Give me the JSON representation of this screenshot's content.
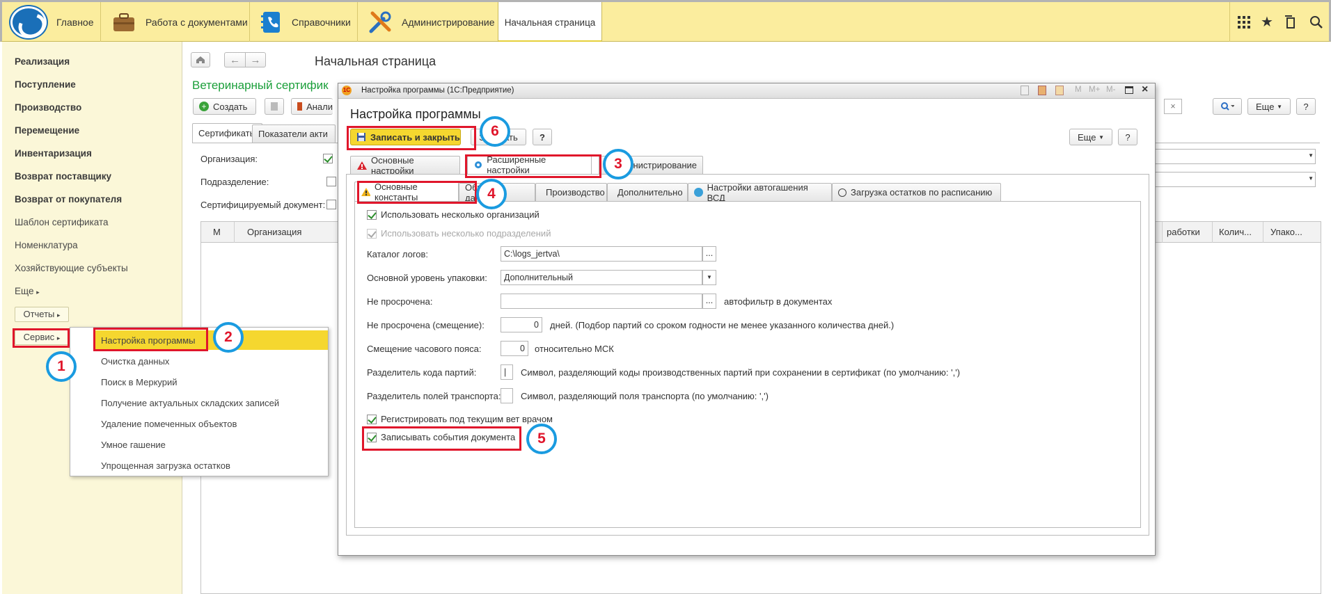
{
  "topbar": {
    "sections": [
      {
        "label": "Главное",
        "icon": "logo-icon"
      },
      {
        "label": "Работа с документами",
        "icon": "briefcase-icon"
      },
      {
        "label": "Справочники",
        "icon": "phonebook-icon"
      },
      {
        "label": "Администрирование",
        "icon": "tools-icon"
      },
      {
        "label": "Начальная страница",
        "icon": ""
      }
    ],
    "right_icons": [
      "apps-grid-icon",
      "star-icon",
      "history-icon",
      "search-icon"
    ]
  },
  "sidebar": {
    "items": [
      {
        "label": "Реализация",
        "bold": true
      },
      {
        "label": "Поступление",
        "bold": true
      },
      {
        "label": "Производство",
        "bold": true
      },
      {
        "label": "Перемещение",
        "bold": true
      },
      {
        "label": "Инвентаризация",
        "bold": true
      },
      {
        "label": "Возврат поставщику",
        "bold": true
      },
      {
        "label": "Возврат от покупателя",
        "bold": true
      },
      {
        "label": "Шаблон сертификата",
        "bold": false
      },
      {
        "label": "Номенклатура",
        "bold": false
      },
      {
        "label": "Хозяйствующие субъекты",
        "bold": false
      },
      {
        "label": "Еще",
        "bold": false
      }
    ],
    "reports_label": "Отчеты",
    "service_label": "Сервис"
  },
  "service_menu": {
    "items": [
      "Настройка программы",
      "Очистка данных",
      "Поиск в Меркурий",
      "Получение актуальных складских записей",
      "Удаление помеченных объектов",
      "Умное гашение",
      "Упрощенная загрузка остатков"
    ]
  },
  "main": {
    "page_title": "Начальная страница",
    "section_title": "Ветеринарный сертифик",
    "create_label": "Создать",
    "analysis_label": "Анали",
    "more_label": "Еще",
    "help_label": "?",
    "tabs": [
      "Сертификаты",
      "Показатели акти"
    ],
    "filters": [
      "Организация:",
      "Подразделение:",
      "Сертифицируемый документ:"
    ],
    "table_headers_left": [
      "М",
      "Организация"
    ],
    "table_headers_right": [
      "работки",
      "Колич...",
      "Упако..."
    ]
  },
  "dialog": {
    "window_title": "Настройка программы  (1С:Предприятие)",
    "title_icons": [
      "save-icon",
      "calculator-icon",
      "calendar-icon",
      "m-icon",
      "m-plus-icon",
      "m-minus-icon",
      "maximize-icon",
      "close-icon"
    ],
    "memory_labels": [
      "M",
      "M+",
      "M-"
    ],
    "heading": "Настройка программы",
    "save_close_label": "Записать и закрыть",
    "save_label": "Записать",
    "more_label": "Еще",
    "help_label": "?",
    "outer_tabs": [
      "Основные настройки",
      "Расширенные настройки",
      "Администрирование"
    ],
    "inner_tabs": [
      "Основные константы",
      "Обмен данными",
      "Производство",
      "Дополнительно",
      "Настройки автогашения ВСД",
      "Загрузка остатков по расписанию"
    ],
    "form": {
      "multi_org_label": "Использовать несколько организаций",
      "multi_dept_label": "Использовать несколько подразделений",
      "log_dir_label": "Каталог логов:",
      "log_dir_value": "C:\\logs_jertva\\",
      "pack_level_label": "Основной уровень упаковки:",
      "pack_level_value": "Дополнительный",
      "not_expired_label": "Не просрочена:",
      "not_expired_value": "",
      "not_expired_note": "автофильтр в документах",
      "not_expired_shift_label": "Не просрочена (смещение):",
      "not_expired_shift_value": "0",
      "not_expired_shift_note": "дней. (Подбор партий со сроком годности не менее указанного количества дней.)",
      "tz_shift_label": "Смещение часового пояса:",
      "tz_shift_value": "0",
      "tz_shift_note": "относительно МСК",
      "batch_sep_label": "Разделитель кода партий:",
      "batch_sep_value": "|",
      "batch_sep_note": "Символ, разделяющий коды производственных партий при сохранении в сертификат (по умолчанию: ',')",
      "transport_sep_label": "Разделитель полей транспорта:",
      "transport_sep_value": "",
      "transport_sep_note": "Символ, разделяющий поля  транспорта  (по умолчанию: ',')",
      "register_vet_label": "Регистрировать под текущим вет врачом",
      "log_events_label": "Записывать события документа"
    }
  },
  "annotations": [
    "1",
    "2",
    "3",
    "4",
    "5",
    "6"
  ],
  "colors": {
    "topbar": "#fbed9e",
    "sidebar": "#fbf7d8",
    "highlight": "#f5d72f",
    "annotation_red": "#e0162b",
    "annotation_blue": "#1a9be0",
    "section_green": "#1b9f3a"
  }
}
